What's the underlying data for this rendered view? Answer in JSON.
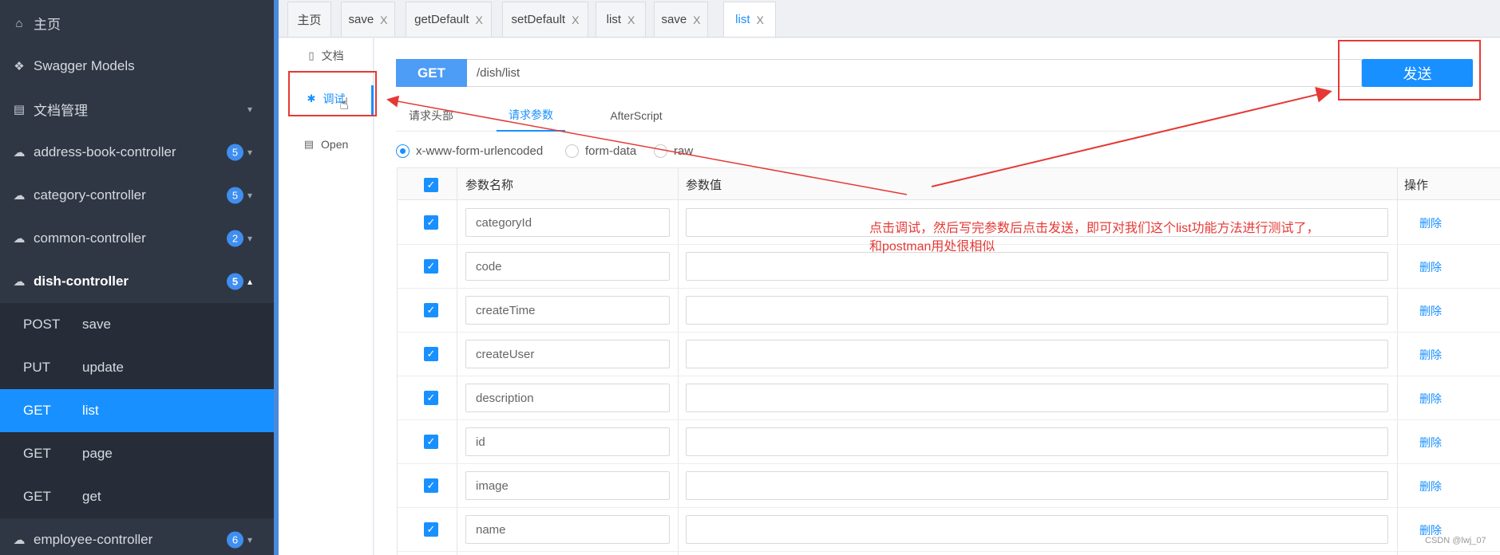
{
  "sidebar": {
    "home": "主页",
    "swagger_models": "Swagger Models",
    "doc_manage": "文档管理",
    "controllers": [
      {
        "label": "address-book-controller",
        "count": "5"
      },
      {
        "label": "category-controller",
        "count": "5"
      },
      {
        "label": "common-controller",
        "count": "2"
      },
      {
        "label": "dish-controller",
        "count": "5"
      }
    ],
    "endpoints": [
      {
        "method": "POST",
        "path": "save"
      },
      {
        "method": "PUT",
        "path": "update"
      },
      {
        "method": "GET",
        "path": "list"
      },
      {
        "method": "GET",
        "path": "page"
      },
      {
        "method": "GET",
        "path": "get"
      }
    ],
    "employee": {
      "label": "employee-controller",
      "count": "6"
    }
  },
  "tabs": [
    {
      "label": "主页"
    },
    {
      "label": "save"
    },
    {
      "label": "getDefault"
    },
    {
      "label": "setDefault"
    },
    {
      "label": "list"
    },
    {
      "label": "save"
    },
    {
      "label": "list"
    }
  ],
  "tab_close": "X",
  "vmenu": {
    "doc": "文档",
    "debug": "调试",
    "open": "Open"
  },
  "request": {
    "method": "GET",
    "url": "/dish/list",
    "send": "发送"
  },
  "subtabs": {
    "headers": "请求头部",
    "params": "请求参数",
    "after": "AfterScript"
  },
  "radios": {
    "urlencoded": "x-www-form-urlencoded",
    "formdata": "form-data",
    "raw": "raw"
  },
  "table": {
    "col_name": "参数名称",
    "col_value": "参数值",
    "col_action": "操作",
    "delete_label": "删除",
    "rows": [
      {
        "name": "categoryId"
      },
      {
        "name": "code"
      },
      {
        "name": "createTime"
      },
      {
        "name": "createUser"
      },
      {
        "name": "description"
      },
      {
        "name": "id"
      },
      {
        "name": "image"
      },
      {
        "name": "name"
      }
    ]
  },
  "annotation": {
    "line1": "点击调试，然后写完参数后点击发送，即可对我们这个list功能方法进行测试了，",
    "line2": "和postman用处很相似"
  },
  "watermark": "CSDN @lwj_07",
  "colors": {
    "sidebar_bg": "#2f3744",
    "accent": "#1890ff",
    "annotation": "#e53935"
  }
}
